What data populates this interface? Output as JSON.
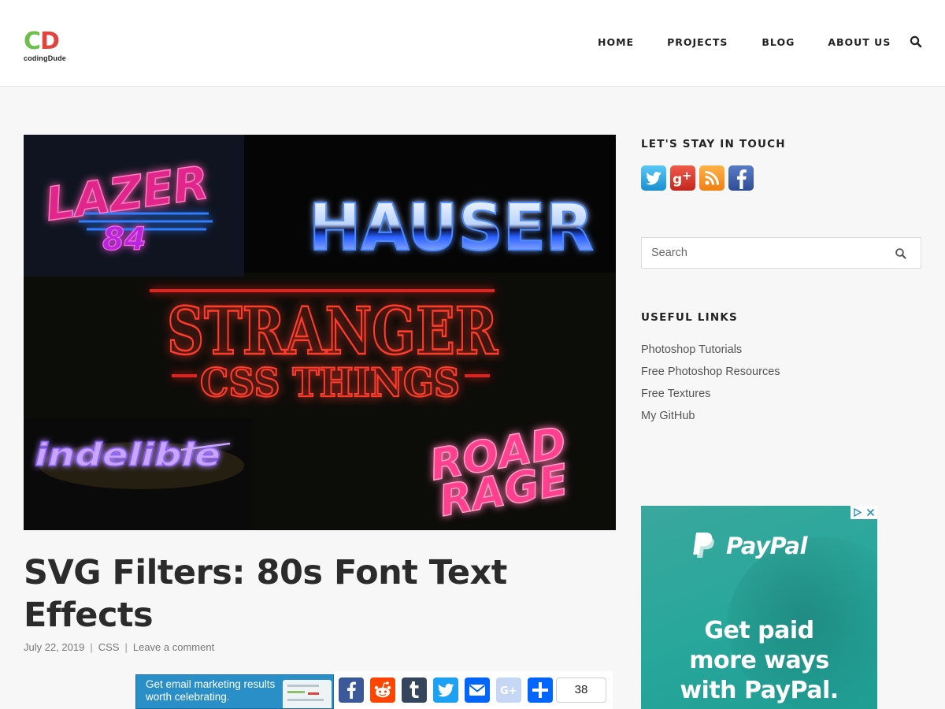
{
  "brand": {
    "logo_mark_c": "C",
    "logo_mark_d": "D",
    "logo_text": "codingDude",
    "colors": {
      "logo_c": "#6cbf4f",
      "logo_d": "#e0443c"
    }
  },
  "nav": {
    "items": [
      {
        "label": "HOME"
      },
      {
        "label": "PROJECTS"
      },
      {
        "label": "BLOG"
      },
      {
        "label": "ABOUT US"
      }
    ],
    "search_icon": "search-icon"
  },
  "hero": {
    "texts": {
      "lazer": "LAZER",
      "eighty_four": "84",
      "hauser": "HAUSER",
      "stranger": "STRANGER",
      "css_things": "CSS THINGS",
      "indelible": "indelible",
      "road": "ROAD",
      "rage": "RAGE"
    }
  },
  "post": {
    "title": "SVG Filters: 80s Font Text Effects",
    "date": "July 22, 2019",
    "category": "CSS",
    "comment_link": "Leave a comment"
  },
  "ad_banner": {
    "text": "Get email marketing results worth celebrating."
  },
  "share": {
    "buttons": [
      {
        "icon": "facebook-icon",
        "color": "#3b5998"
      },
      {
        "icon": "reddit-icon",
        "color": "#ff4500"
      },
      {
        "icon": "tumblr-icon",
        "color": "#35465c"
      },
      {
        "icon": "twitter-icon",
        "color": "#1da1f2"
      },
      {
        "icon": "email-icon",
        "color": "#0166ff"
      },
      {
        "icon": "google-plus-icon",
        "color": "#c6d6f5"
      },
      {
        "icon": "share-plus-icon",
        "color": "#0166ff"
      }
    ],
    "count": "38"
  },
  "sidebar": {
    "stay_in_touch_title": "LET'S STAY IN TOUCH",
    "social": [
      {
        "icon": "twitter-icon"
      },
      {
        "icon": "google-plus-icon"
      },
      {
        "icon": "rss-icon"
      },
      {
        "icon": "facebook-icon"
      }
    ],
    "search_placeholder": "Search",
    "useful_links_title": "USEFUL LINKS",
    "useful_links": [
      {
        "label": "Photoshop Tutorials"
      },
      {
        "label": "Free Photoshop Resources"
      },
      {
        "label": "Free Textures"
      },
      {
        "label": "My GitHub"
      }
    ]
  },
  "paypal_ad": {
    "logo_text": "PayPal",
    "headline_line1": "Get paid",
    "headline_line2": "more ways",
    "headline_line3": "with PayPal."
  }
}
